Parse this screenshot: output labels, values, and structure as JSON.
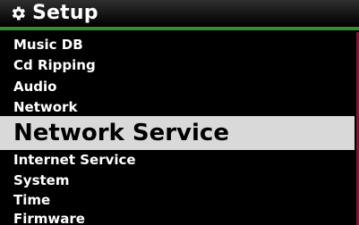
{
  "header": {
    "title": "Setup",
    "icon": "gear-icon",
    "accent_color": "#2e8f34"
  },
  "menu": {
    "items": [
      {
        "label": "Music DB",
        "selected": false
      },
      {
        "label": "Cd Ripping",
        "selected": false
      },
      {
        "label": "Audio",
        "selected": false
      },
      {
        "label": "Network",
        "selected": false
      },
      {
        "label": "Network Service",
        "selected": true
      },
      {
        "label": "Internet Service",
        "selected": false
      },
      {
        "label": "System",
        "selected": false
      },
      {
        "label": "Time",
        "selected": false
      },
      {
        "label": "Firmware",
        "selected": false
      }
    ],
    "highlight_color": "#d9d9d9",
    "scrollbar_color": "#7a1534"
  }
}
